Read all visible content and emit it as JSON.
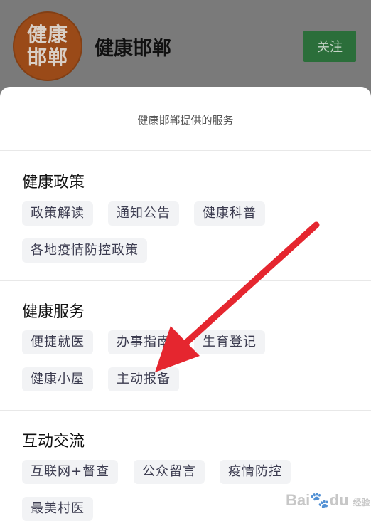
{
  "header": {
    "avatar_text_line1": "健康",
    "avatar_text_line2": "邯郸",
    "account_name": "健康邯郸",
    "follow_label": "关注"
  },
  "sheet": {
    "title": "健康邯郸提供的服务",
    "sections": [
      {
        "title": "健康政策",
        "items": [
          "政策解读",
          "通知公告",
          "健康科普",
          "各地疫情防控政策"
        ]
      },
      {
        "title": "健康服务",
        "items": [
          "便捷就医",
          "办事指南",
          "生育登记",
          "健康小屋",
          "主动报备"
        ]
      },
      {
        "title": "互动交流",
        "items": [
          "互联网+督查",
          "公众留言",
          "疫情防控",
          "最美村医"
        ]
      }
    ]
  },
  "watermark": {
    "text": "Bai",
    "paw": "du",
    "suffix": "经验"
  },
  "colors": {
    "follow_green": "#2b6e3a",
    "arrow_red": "#e5262f",
    "avatar_brown": "#9a4a18"
  }
}
